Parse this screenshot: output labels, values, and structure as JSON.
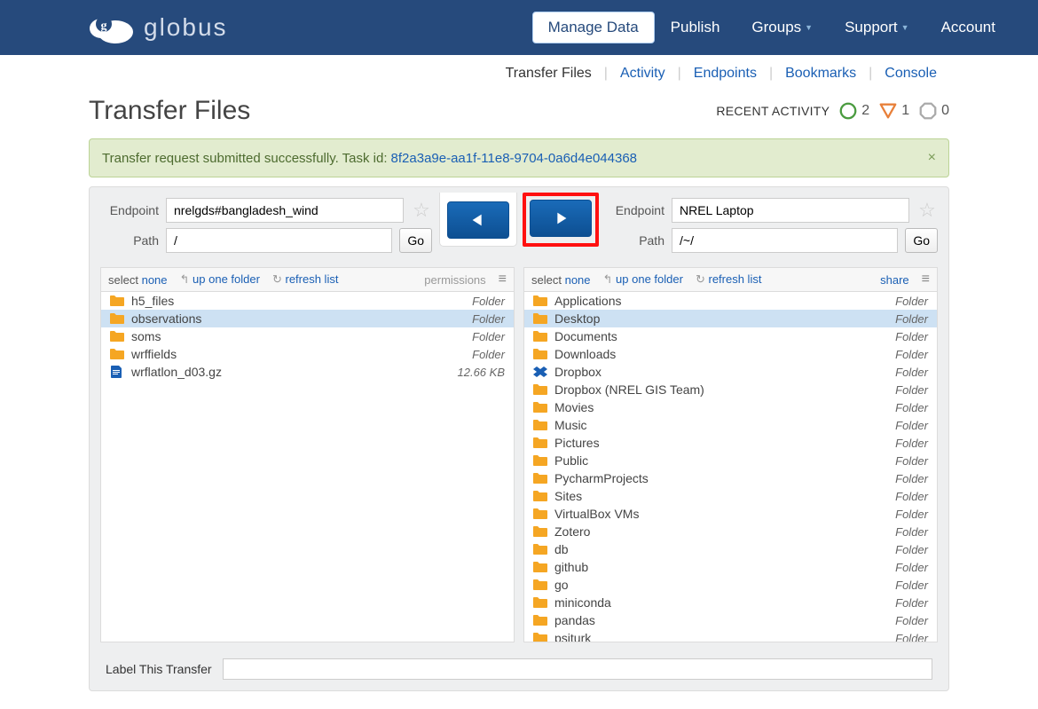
{
  "logo": {
    "text": "globus"
  },
  "nav": {
    "items": [
      {
        "label": "Manage Data",
        "active": true,
        "dropdown": false
      },
      {
        "label": "Publish",
        "dropdown": false
      },
      {
        "label": "Groups",
        "dropdown": true
      },
      {
        "label": "Support",
        "dropdown": true
      },
      {
        "label": "Account",
        "dropdown": false
      }
    ]
  },
  "sub_nav": {
    "items": [
      {
        "label": "Transfer Files",
        "active": true
      },
      {
        "label": "Activity"
      },
      {
        "label": "Endpoints"
      },
      {
        "label": "Bookmarks"
      },
      {
        "label": "Console"
      }
    ]
  },
  "page_title": "Transfer Files",
  "recent_activity": {
    "label": "RECENT ACTIVITY",
    "success": 2,
    "warning": 1,
    "other": 0
  },
  "banner": {
    "text": "Transfer request submitted successfully. Task id:",
    "task_id": "8f2a3a9e-aa1f-11e8-9704-0a6d4e044368"
  },
  "left_endpoint": {
    "endpoint_label": "Endpoint",
    "endpoint_value": "nrelgds#bangladesh_wind",
    "path_label": "Path",
    "path_value": "/",
    "go": "Go"
  },
  "right_endpoint": {
    "endpoint_label": "Endpoint",
    "endpoint_value": "NREL Laptop",
    "path_label": "Path",
    "path_value": "/~/",
    "go": "Go"
  },
  "toolbar": {
    "select": "select",
    "none": "none",
    "up": "up one folder",
    "refresh": "refresh list",
    "permissions": "permissions",
    "share": "share"
  },
  "left_files": [
    {
      "name": "h5_files",
      "type": "folder",
      "meta": "Folder",
      "selected": false
    },
    {
      "name": "observations",
      "type": "folder",
      "meta": "Folder",
      "selected": true
    },
    {
      "name": "soms",
      "type": "folder",
      "meta": "Folder",
      "selected": false
    },
    {
      "name": "wrffields",
      "type": "folder",
      "meta": "Folder",
      "selected": false
    },
    {
      "name": "wrflatlon_d03.gz",
      "type": "file",
      "meta": "12.66 KB",
      "selected": false
    }
  ],
  "right_files": [
    {
      "name": "Applications",
      "type": "folder",
      "meta": "Folder",
      "selected": false
    },
    {
      "name": "Desktop",
      "type": "folder",
      "meta": "Folder",
      "selected": true
    },
    {
      "name": "Documents",
      "type": "folder",
      "meta": "Folder",
      "selected": false
    },
    {
      "name": "Downloads",
      "type": "folder",
      "meta": "Folder",
      "selected": false
    },
    {
      "name": "Dropbox",
      "type": "dropbox",
      "meta": "Folder",
      "selected": false
    },
    {
      "name": "Dropbox (NREL GIS Team)",
      "type": "folder",
      "meta": "Folder",
      "selected": false
    },
    {
      "name": "Movies",
      "type": "folder",
      "meta": "Folder",
      "selected": false
    },
    {
      "name": "Music",
      "type": "folder",
      "meta": "Folder",
      "selected": false
    },
    {
      "name": "Pictures",
      "type": "folder",
      "meta": "Folder",
      "selected": false
    },
    {
      "name": "Public",
      "type": "folder",
      "meta": "Folder",
      "selected": false
    },
    {
      "name": "PycharmProjects",
      "type": "folder",
      "meta": "Folder",
      "selected": false
    },
    {
      "name": "Sites",
      "type": "folder",
      "meta": "Folder",
      "selected": false
    },
    {
      "name": "VirtualBox VMs",
      "type": "folder",
      "meta": "Folder",
      "selected": false
    },
    {
      "name": "Zotero",
      "type": "folder",
      "meta": "Folder",
      "selected": false
    },
    {
      "name": "db",
      "type": "folder",
      "meta": "Folder",
      "selected": false
    },
    {
      "name": "github",
      "type": "folder",
      "meta": "Folder",
      "selected": false
    },
    {
      "name": "go",
      "type": "folder",
      "meta": "Folder",
      "selected": false
    },
    {
      "name": "miniconda",
      "type": "folder",
      "meta": "Folder",
      "selected": false
    },
    {
      "name": "pandas",
      "type": "folder",
      "meta": "Folder",
      "selected": false
    },
    {
      "name": "psiturk",
      "type": "folder",
      "meta": "Folder",
      "selected": false
    }
  ],
  "label_transfer": {
    "label": "Label This Transfer",
    "value": ""
  }
}
